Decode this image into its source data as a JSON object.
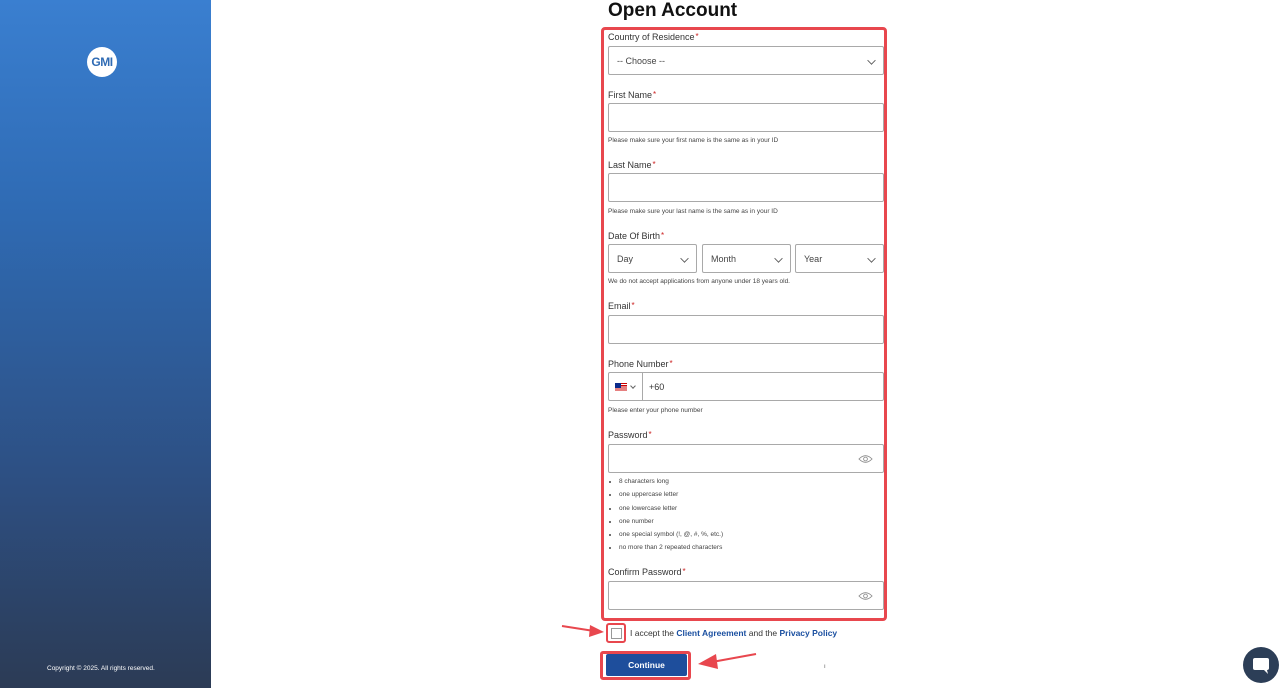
{
  "sidebar": {
    "logo_text": "GMI",
    "copyright": "Copyright © 2025. All rights reserved."
  },
  "form": {
    "title": "Open Account",
    "required_mark": "*",
    "country": {
      "label": "Country of Residence",
      "value": "-- Choose --"
    },
    "first_name": {
      "label": "First Name",
      "value": "",
      "hint": "Please make sure your first name is the same as in your ID"
    },
    "last_name": {
      "label": "Last Name",
      "value": "",
      "hint": "Please make sure your last name is the same as in your ID"
    },
    "dob": {
      "label": "Date Of Birth",
      "day": "Day",
      "month": "Month",
      "year": "Year",
      "hint": "We do not accept applications from anyone under 18 years old."
    },
    "email": {
      "label": "Email",
      "value": ""
    },
    "phone": {
      "label": "Phone Number",
      "code": "+60",
      "hint": "Please enter your phone number",
      "flag": "malaysia-flag"
    },
    "password": {
      "label": "Password",
      "value": "",
      "rules": [
        "8 characters long",
        "one uppercase letter",
        "one lowercase letter",
        "one number",
        "one special symbol (!, @, #, %, etc.)",
        "no more than 2 repeated characters"
      ]
    },
    "confirm_password": {
      "label": "Confirm Password",
      "value": ""
    },
    "agreement": {
      "prefix": "I accept the",
      "client_agreement": "Client Agreement",
      "middle": "and the",
      "privacy_policy": "Privacy Policy",
      "checked": false
    },
    "continue_label": "Continue",
    "stray_mark": "ı"
  },
  "colors": {
    "highlight": "#e8474e",
    "button": "#1e4e9c",
    "link": "#1a4fa0"
  },
  "icons": [
    "chevron-down-icon",
    "eye-icon",
    "chat-icon",
    "malaysia-flag"
  ]
}
